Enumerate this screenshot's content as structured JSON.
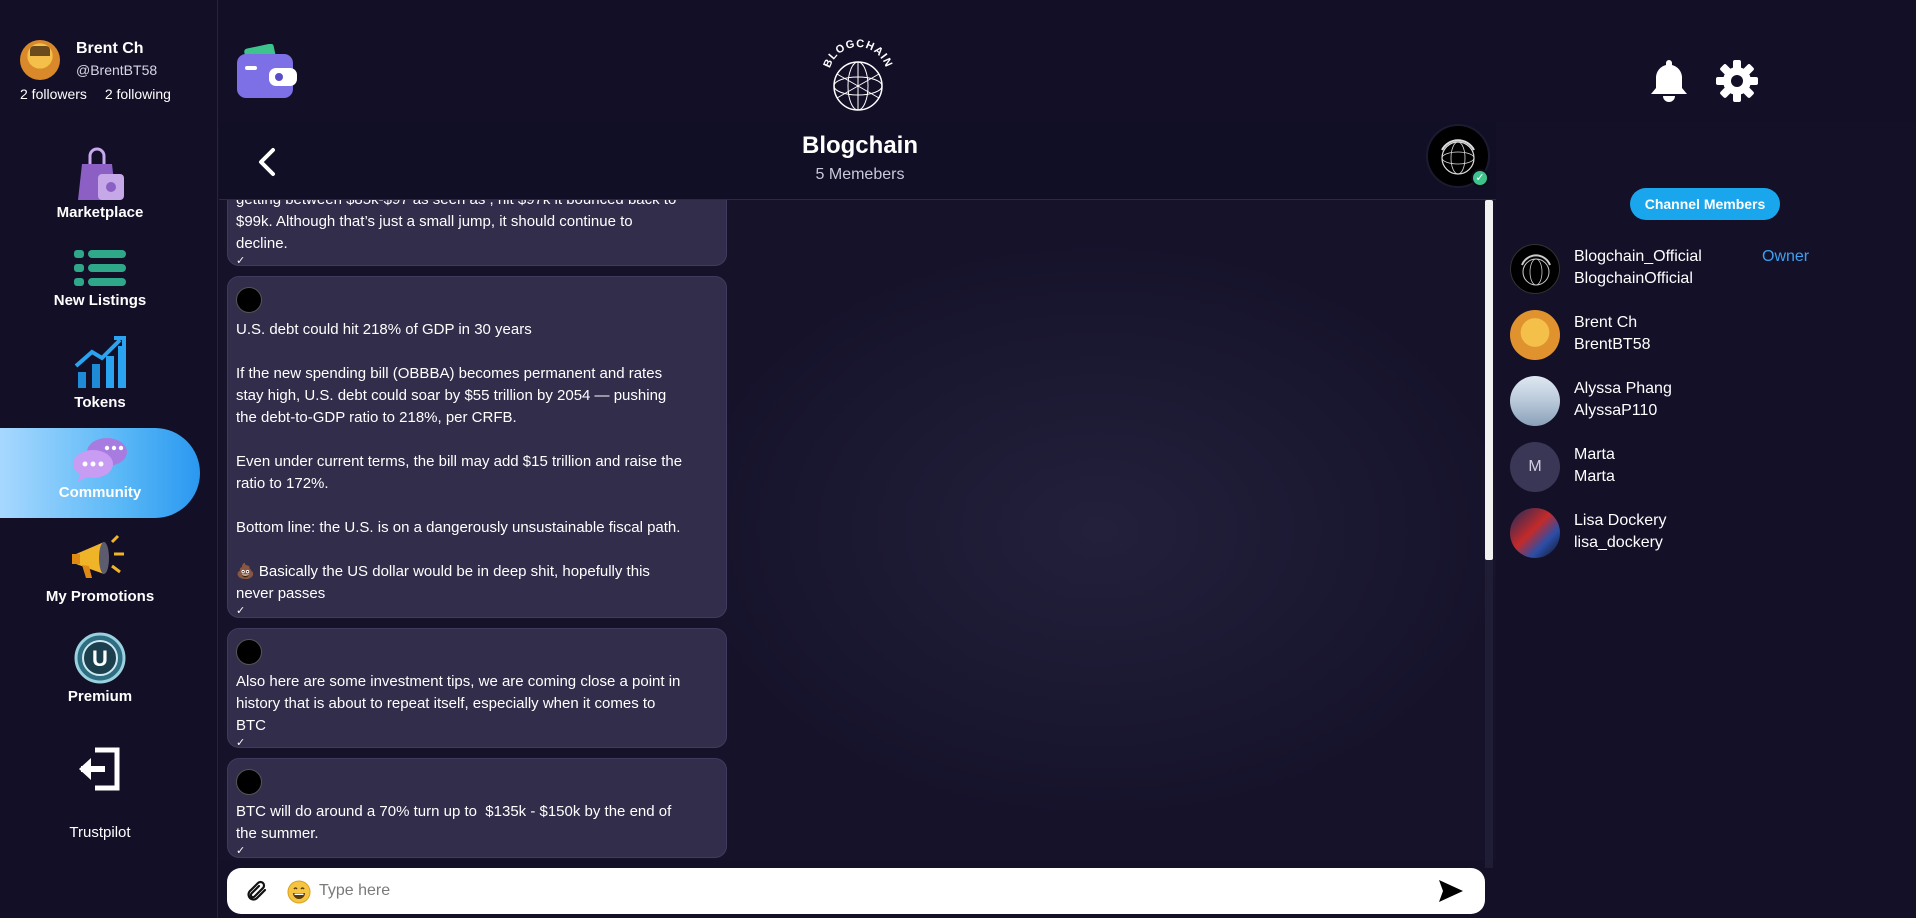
{
  "profile": {
    "name": "Brent Ch",
    "handle": "@BrentBT58",
    "followers": "2 followers",
    "following": "2 following"
  },
  "nav": {
    "marketplace": "Marketplace",
    "new_listings": "New Listings",
    "tokens": "Tokens",
    "community": "Community",
    "my_promotions": "My Promotions",
    "premium": "Premium",
    "trustpilot": "Trustpilot"
  },
  "brand": {
    "logo_text": "BLOGCHAIN"
  },
  "channel": {
    "title": "Blogchain",
    "members_count": "5 Memebers"
  },
  "messages": [
    {
      "text": "getting between $85k-$97 as seen as , hit $97k it bounced back to\n$99k. Although that’s just a small jump, it should continue to\ndecline."
    },
    {
      "text": "U.S. debt could hit 218% of GDP in 30 years\n\nIf the new spending bill (OBBBA) becomes permanent and rates\nstay high, U.S. debt could soar by $55 trillion by 2054 — pushing\nthe debt-to-GDP ratio to 218%, per CRFB.\n\nEven under current terms, the bill may add $15 trillion and raise the\nratio to 172%.\n\nBottom line: the U.S. is on a dangerously unsustainable fiscal path.\n\n💩 Basically the US dollar would be in deep shit, hopefully this\nnever passes"
    },
    {
      "text": "Also here are some investment tips, we are coming close a point in\nhistory that is about to repeat itself, especially when it comes to\nBTC"
    },
    {
      "text": "BTC will do around a 70% turn up to  $135k - $150k by the end of\nthe summer."
    }
  ],
  "read_mark": "✓",
  "composer": {
    "placeholder": "Type here"
  },
  "members_panel": {
    "button_label": "Channel Members",
    "members": [
      {
        "name": "Blogchain_Official",
        "handle": "BlogchainOfficial",
        "role": "Owner"
      },
      {
        "name": "Brent Ch",
        "handle": "BrentBT58"
      },
      {
        "name": "Alyssa Phang",
        "handle": "AlyssaP110"
      },
      {
        "name": "Marta",
        "handle": "Marta",
        "initial": "M"
      },
      {
        "name": "Lisa Dockery",
        "handle": "lisa_dockery"
      }
    ]
  },
  "colors": {
    "background": "#131027",
    "bubble": "#312d4a",
    "accent_blue": "#19a6ec",
    "owner_blue": "#3f9ff0",
    "active_nav": "#5ab8f6"
  },
  "icons": [
    "wallet-icon",
    "blogchain-logo",
    "bell-icon",
    "gear-icon",
    "back-arrow-icon",
    "paperclip-icon",
    "emoji-icon",
    "send-icon",
    "marketplace-icon",
    "listings-icon",
    "tokens-icon",
    "community-icon",
    "megaphone-icon",
    "premium-icon",
    "logout-icon"
  ]
}
